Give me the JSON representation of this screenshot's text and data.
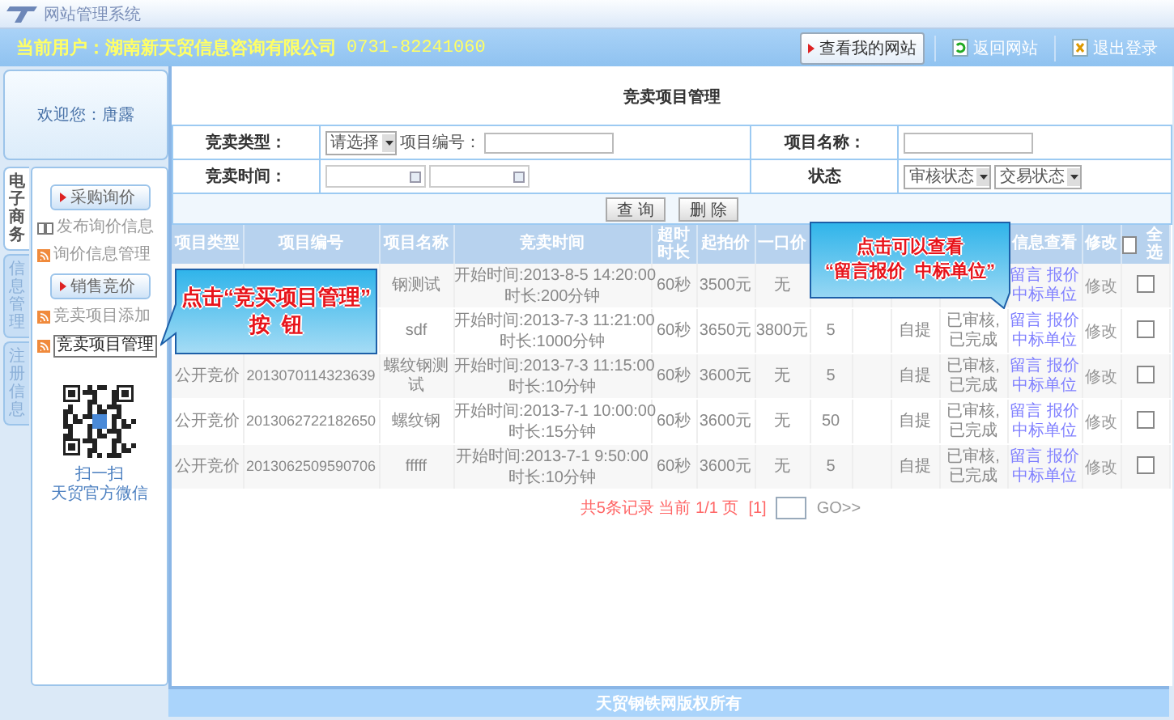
{
  "window": {
    "title": "网站管理系统"
  },
  "header": {
    "user_label": "当前用户：湖南新天贸信息咨询有限公司",
    "phone": "0731-82241060",
    "buttons": [
      {
        "kind": "view",
        "label": "查看我的网站"
      },
      {
        "kind": "back",
        "label": "返回网站"
      },
      {
        "kind": "exit",
        "label": "退出登录"
      }
    ]
  },
  "welcome": "欢迎您：唐露",
  "side_tabs": [
    {
      "label": "电子商务",
      "selected": true
    },
    {
      "label": "信息管理",
      "selected": false
    },
    {
      "label": "注册信息",
      "selected": false
    }
  ],
  "sidebar": {
    "items": [
      {
        "kind": "section",
        "label": "采购询价"
      },
      {
        "kind": "book",
        "label": "发布询价信息",
        "selected": false
      },
      {
        "kind": "feed",
        "label": "询价信息管理",
        "selected": false
      },
      {
        "kind": "section",
        "label": "销售竞价"
      },
      {
        "kind": "feed",
        "label": "竞卖项目添加",
        "selected": false
      },
      {
        "kind": "feed",
        "label": "竞卖项目管理",
        "selected": true
      }
    ],
    "qr_caption": [
      "扫一扫",
      "天贸官方微信"
    ]
  },
  "page_title": "竞卖项目管理",
  "filters": {
    "type_label": "竞卖类型：",
    "type_select": "请选择",
    "code_label": "项目编号：",
    "name_label": "项目名称：",
    "time_label": "竞卖时间：",
    "status_label": "状态",
    "status_selects": [
      "审核状态",
      "交易状态"
    ],
    "buttons": [
      "查 询",
      "删 除"
    ]
  },
  "table": {
    "columns": [
      {
        "label": "项目类型"
      },
      {
        "label": "项目编号"
      },
      {
        "label": "项目名称"
      },
      {
        "label": "竞卖时间"
      },
      {
        "label": "超时时长"
      },
      {
        "label": "起拍价"
      },
      {
        "label": "一口价"
      },
      {},
      {},
      {},
      {},
      {
        "label": "信息查看"
      },
      {
        "label": "修改"
      },
      {
        "label": "全选",
        "kind": "checkall",
        "checked": false
      }
    ],
    "rows": [
      {
        "cells": [
          {},
          {},
          {
            "text": "钢测试"
          },
          {
            "kind": "time",
            "lines": [
              "开始时间:2013-8-5 14:20:00",
              "时长:200分钟"
            ]
          },
          {
            "text": "60秒"
          },
          {
            "text": "3500元"
          },
          {
            "text": "无"
          },
          {},
          {},
          {},
          {},
          {
            "kind": "links",
            "links": [
              "留言",
              "报价",
              "中标单位"
            ]
          },
          {
            "kind": "link",
            "text": "修改"
          },
          {
            "kind": "checkbox",
            "checked": false
          }
        ]
      },
      {
        "cells": [
          {},
          {},
          {
            "text": "sdf"
          },
          {
            "kind": "time",
            "lines": [
              "开始时间:2013-7-3 11:21:00",
              "时长:1000分钟"
            ]
          },
          {
            "text": "60秒"
          },
          {
            "text": "3650元"
          },
          {
            "text": "3800元"
          },
          {
            "text": "5"
          },
          {},
          {
            "text": "自提"
          },
          {
            "text": "已审核,已完成"
          },
          {
            "kind": "links",
            "links": [
              "留言",
              "报价",
              "中标单位"
            ]
          },
          {
            "kind": "link",
            "text": "修改"
          },
          {
            "kind": "checkbox",
            "checked": false
          }
        ]
      },
      {
        "cells": [
          {
            "text": "公开竞价"
          },
          {
            "text": "2013070114323639"
          },
          {
            "text": "螺纹钢测试"
          },
          {
            "kind": "time",
            "lines": [
              "开始时间:2013-7-3 11:15:00",
              "时长:10分钟"
            ]
          },
          {
            "text": "60秒"
          },
          {
            "text": "3600元"
          },
          {
            "text": "无"
          },
          {
            "text": "5"
          },
          {},
          {
            "text": "自提"
          },
          {
            "text": "已审核,已完成"
          },
          {
            "kind": "links",
            "links": [
              "留言",
              "报价",
              "中标单位"
            ]
          },
          {
            "kind": "link",
            "text": "修改"
          },
          {
            "kind": "checkbox",
            "checked": false
          }
        ]
      },
      {
        "cells": [
          {
            "text": "公开竞价"
          },
          {
            "text": "2013062722182650"
          },
          {
            "text": "螺纹钢"
          },
          {
            "kind": "time",
            "lines": [
              "开始时间:2013-7-1 10:00:00",
              "时长:15分钟"
            ]
          },
          {
            "text": "60秒"
          },
          {
            "text": "3600元"
          },
          {
            "text": "无"
          },
          {
            "text": "50"
          },
          {},
          {
            "text": "自提"
          },
          {
            "text": "已审核,已完成"
          },
          {
            "kind": "links",
            "links": [
              "留言",
              "报价",
              "中标单位"
            ]
          },
          {
            "kind": "link",
            "text": "修改"
          },
          {
            "kind": "checkbox",
            "checked": false
          }
        ]
      },
      {
        "cells": [
          {
            "text": "公开竞价"
          },
          {
            "text": "2013062509590706"
          },
          {
            "text": "fffff"
          },
          {
            "kind": "time",
            "lines": [
              "开始时间:2013-7-1 9:50:00",
              "时长:10分钟"
            ]
          },
          {
            "text": "60秒"
          },
          {
            "text": "3600元"
          },
          {
            "text": "无"
          },
          {
            "text": "5"
          },
          {},
          {
            "text": "自提"
          },
          {
            "text": "已审核,已完成"
          },
          {
            "kind": "links",
            "links": [
              "留言",
              "报价",
              "中标单位"
            ]
          },
          {
            "kind": "link",
            "text": "修改"
          },
          {
            "kind": "checkbox",
            "checked": false
          }
        ]
      }
    ]
  },
  "pagination": {
    "summary": "共5条记录 当前 1/1 页",
    "page": "[1]",
    "go": "GO>>"
  },
  "footer": "天贸钢铁网版权所有",
  "callouts": [
    {
      "lines": [
        "点击“竞买项目管理”",
        "按  钮"
      ]
    },
    {
      "lines": [
        "点击可以查看",
        "“留言报价  中标单位”"
      ]
    }
  ]
}
